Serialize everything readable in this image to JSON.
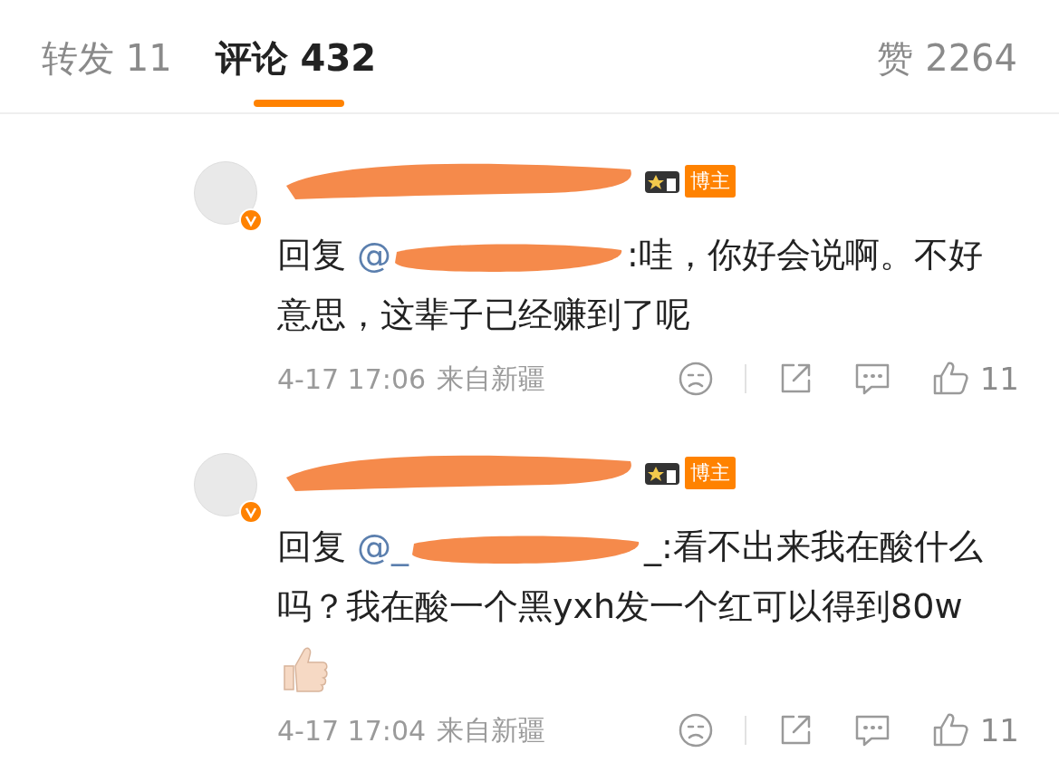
{
  "tabs": [
    {
      "label": "转发 11",
      "selected": false
    },
    {
      "label": "评论 432",
      "selected": true
    },
    {
      "label": "赞 2264",
      "selected": false
    }
  ],
  "comments": [
    {
      "badge": "博主",
      "reply_prefix": "回复 ",
      "mention": "@",
      "text": ":哇，你好会说啊。不好意思，这辈子已经赚到了呢",
      "ends_with_thumbs": false,
      "time": "4-17 17:06",
      "source": "来自新疆",
      "likes": "11"
    },
    {
      "badge": "博主",
      "reply_prefix": "回复 ",
      "mention": "@_",
      "text": "_:看不出来我在酸什么吗？我在酸一个黑yxh发一个红可以得到80w",
      "ends_with_thumbs": true,
      "time": "4-17 17:04",
      "source": "来自新疆",
      "likes": "11"
    }
  ]
}
